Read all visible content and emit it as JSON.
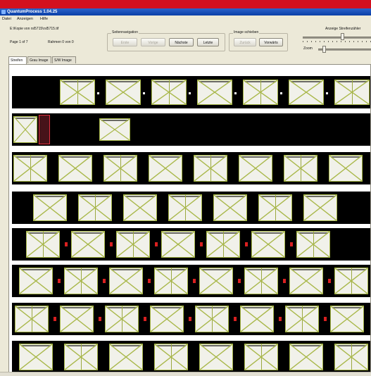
{
  "window": {
    "title": "QuantumProcess 1.04.25"
  },
  "menu": {
    "items": [
      "Datei",
      "Anzeigen",
      "Hilfe"
    ]
  },
  "header": {
    "file_path": "E:\\Kopie von rsl5715\\rsl5715.tif",
    "page_info": "Page 1 of 7",
    "frame_info": "Rahmen 0 von 0"
  },
  "seitennavigation": {
    "label": "Seitennavigation",
    "buttons": [
      {
        "label": "Erste",
        "enabled": false
      },
      {
        "label": "Vorige",
        "enabled": false
      },
      {
        "label": "Nächste",
        "enabled": true
      },
      {
        "label": "Letzte",
        "enabled": true
      }
    ]
  },
  "image_shift": {
    "label": "Image schieben",
    "buttons": [
      {
        "label": "Zurück",
        "enabled": false
      },
      {
        "label": "Vorwärts",
        "enabled": true
      }
    ]
  },
  "sliders": {
    "strip_counter_label": "Anzeige Streifenzähler",
    "zoom_label": "Zoom"
  },
  "tabs": [
    {
      "label": "Streifen",
      "active": true
    },
    {
      "label": "Grau Image",
      "active": false
    },
    {
      "label": "S/W Image",
      "active": false
    }
  ],
  "colors": {
    "page_border": "#a5b545",
    "strip_background": "#000000",
    "marker_red": "#d92020",
    "title_bar": "#0a3fa8"
  }
}
